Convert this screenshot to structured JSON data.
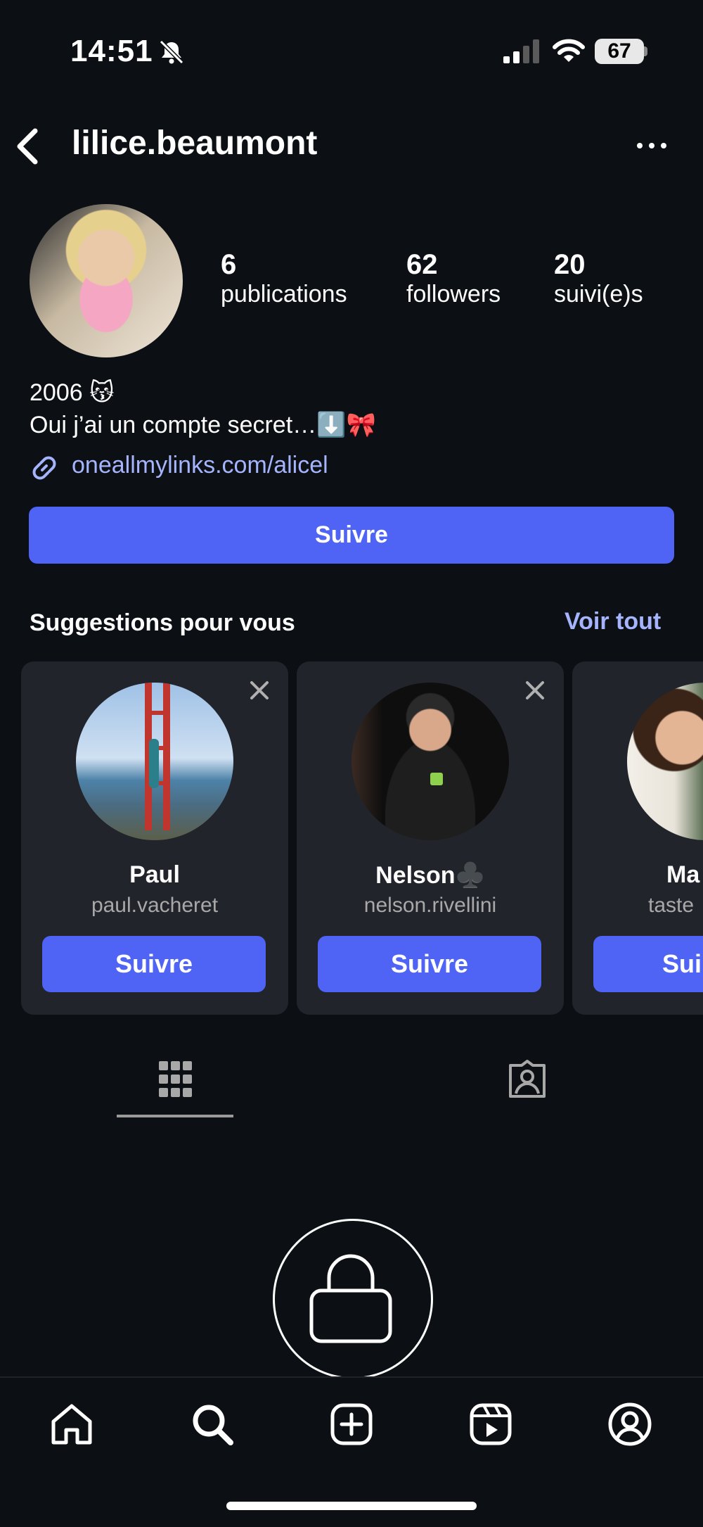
{
  "status_bar": {
    "time": "14:51",
    "battery": "67",
    "icons": [
      "bell-slash-icon",
      "signal-icon",
      "wifi-icon",
      "battery-icon"
    ]
  },
  "header": {
    "username": "lilice.beaumont",
    "back_icon": "chevron-left-icon",
    "more_icon": "more-icon"
  },
  "profile": {
    "stats": [
      {
        "value": "6",
        "label": "publications"
      },
      {
        "value": "62",
        "label": "followers"
      },
      {
        "value": "20",
        "label": "suivi(e)s"
      }
    ],
    "bio_lines": [
      "2006 😽",
      "Oui j’ai un compte secret…⬇️🎀"
    ],
    "link": "oneallmylinks.com/alicel",
    "follow_label": "Suivre"
  },
  "suggestions": {
    "title": "Suggestions pour vous",
    "see_all": "Voir tout",
    "cards": [
      {
        "name": "Paul",
        "handle": "paul.vacheret",
        "button": "Suivre"
      },
      {
        "name": "Nelson♣️",
        "handle": "nelson.rivellini",
        "button": "Suivre"
      },
      {
        "name": "Ma",
        "handle": "taste",
        "button": "Sui"
      }
    ]
  },
  "tabs": [
    "grid-icon",
    "tagged-icon"
  ],
  "private_icon": "lock-icon",
  "bottom_nav": [
    "home-icon",
    "search-icon",
    "create-icon",
    "reels-icon",
    "profile-icon"
  ],
  "colors": {
    "background": "#0c1014",
    "accent": "#4f63f5",
    "link": "#a5b4fc",
    "card": "#22242b"
  }
}
